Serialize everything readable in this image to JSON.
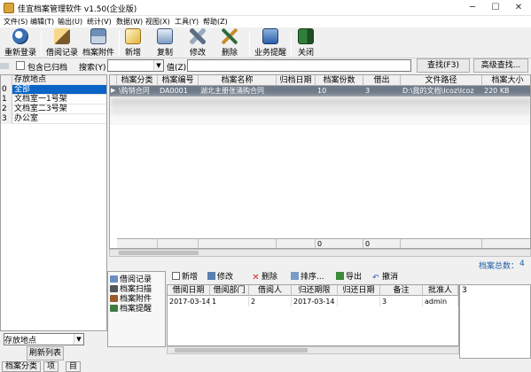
{
  "window": {
    "title": "佳宜档案管理软件 v1.50(企业版)",
    "minimize": "─",
    "maximize": "☐",
    "close": "✕"
  },
  "menu": [
    "文件(S)",
    "编辑(T)",
    "输出(U)",
    "统计(V)",
    "数据(W)",
    "视图(X)",
    "工具(Y)",
    "帮助(Z)"
  ],
  "toolbar": {
    "relogin": "重新登录",
    "borrow": "借阅记录",
    "attach": "档案附件",
    "add": "新增",
    "copy": "复制",
    "edit": "修改",
    "delete": "删除",
    "remind": "业务提醒",
    "close": "关闭"
  },
  "search": {
    "include_archived": "包含已归档",
    "field_label": "搜索(Y)",
    "field_value": "",
    "value_label": "值(Z)",
    "value": "",
    "find_button": "查找(F3)",
    "advanced_button": "高级查找..."
  },
  "left": {
    "header": "存放地点",
    "rows": [
      {
        "num": "0",
        "text": "全部",
        "selected": true
      },
      {
        "num": "1",
        "text": "文档室一1号架",
        "selected": false
      },
      {
        "num": "2",
        "text": "文档室二3号架",
        "selected": false
      },
      {
        "num": "3",
        "text": "办公室",
        "selected": false
      }
    ],
    "filter_value": "存放地点",
    "refresh_button": "刷新列表",
    "tabs": [
      "档案分类",
      "项",
      "目"
    ]
  },
  "grid": {
    "columns": [
      "档案分类",
      "档案编号",
      "档案名称",
      "归档日期",
      "档案份数",
      "借出",
      "文件路径",
      "档案大小"
    ],
    "rows": [
      [
        "\\购销合同",
        "DA0001",
        "湖北主册张涌购合同",
        "",
        "10",
        "3",
        "D:\\我的文档\\Icoz\\Icoz",
        "220 KB"
      ]
    ],
    "footer": [
      "",
      "",
      "",
      "",
      "0",
      "0",
      "",
      ""
    ],
    "total_label": "档案总数：",
    "total_value": "4"
  },
  "vtabs": [
    "借阅记录",
    "档案扫描",
    "档案附件",
    "档案提醒"
  ],
  "subtoolbar": [
    "新增",
    "修改",
    "删除",
    "排序...",
    "导出",
    "撤消"
  ],
  "subgrid": {
    "columns": [
      "借阅日期",
      "借阅部门",
      "借阅人",
      "归还期限",
      "归还日期",
      "备注",
      "批准人"
    ],
    "rows": [
      [
        "2017-03-14",
        "1",
        "2",
        "2017-03-14",
        "",
        "3",
        "admin"
      ]
    ]
  },
  "memo": "3"
}
